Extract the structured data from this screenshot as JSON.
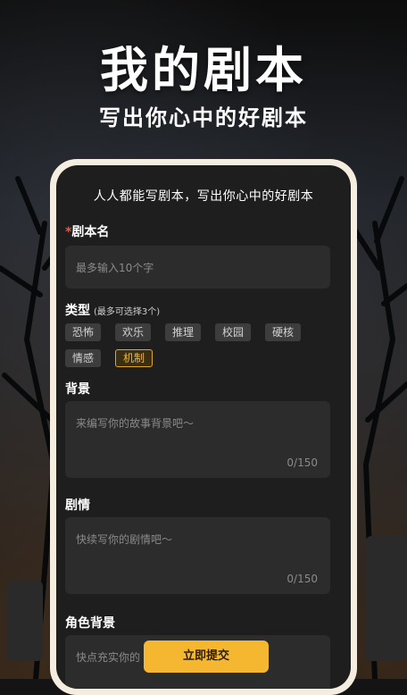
{
  "hero": {
    "title": "我的剧本",
    "subtitle": "写出你心中的好剧本"
  },
  "form": {
    "header": "人人都能写剧本，写出你心中的好剧本",
    "script_name": {
      "required_mark": "*",
      "label": "剧本名",
      "placeholder": "最多输入10个字"
    },
    "type": {
      "label": "类型",
      "hint": "(最多可选择3个)",
      "chips": [
        "恐怖",
        "欢乐",
        "推理",
        "校园",
        "硬核",
        "情感",
        "机制"
      ],
      "selected": "机制"
    },
    "background": {
      "label": "背景",
      "placeholder": "来编写你的故事背景吧～",
      "count": "0/150"
    },
    "plot": {
      "label": "剧情",
      "placeholder": "快续写你的剧情吧～",
      "count": "0/150"
    },
    "role": {
      "label": "角色背景",
      "placeholder": "快点充实你的"
    },
    "submit_label": "立即提交"
  },
  "colors": {
    "accent": "#f5b72f",
    "required": "#e25b45",
    "panel": "#1e1e1e",
    "field": "#2c2c2c"
  }
}
